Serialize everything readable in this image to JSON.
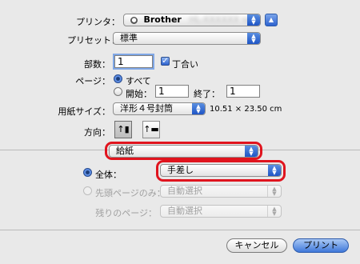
{
  "printer": {
    "label": "プリンタ：",
    "value": "Brother",
    "blurred_model": "HL-XXXXXX series"
  },
  "preset": {
    "label": "プリセット：",
    "value": "標準"
  },
  "copies": {
    "label": "部数：",
    "value": "1",
    "collate_label": "丁合い"
  },
  "pages": {
    "label": "ページ：",
    "all_label": "すべて",
    "range_from_label": "開始：",
    "range_from_value": "1",
    "range_to_label": "終了：",
    "range_to_value": "1"
  },
  "paper": {
    "label": "用紙サイズ：",
    "value": "洋形４号封筒",
    "dimensions": "10.51 × 23.50 cm"
  },
  "orientation": {
    "label": "方向："
  },
  "section_popup": {
    "value": "給紙"
  },
  "feed": {
    "all_label": "全体：",
    "all_value": "手差し",
    "first_page_label": "先頭ページのみ：",
    "first_page_value": "自動選択",
    "remaining_label": "残りのページ：",
    "remaining_value": "自動選択"
  },
  "buttons": {
    "cancel": "キャンセル",
    "print": "プリント"
  },
  "colors": {
    "highlight": "#e0141e",
    "accent": "#2e63cf"
  }
}
